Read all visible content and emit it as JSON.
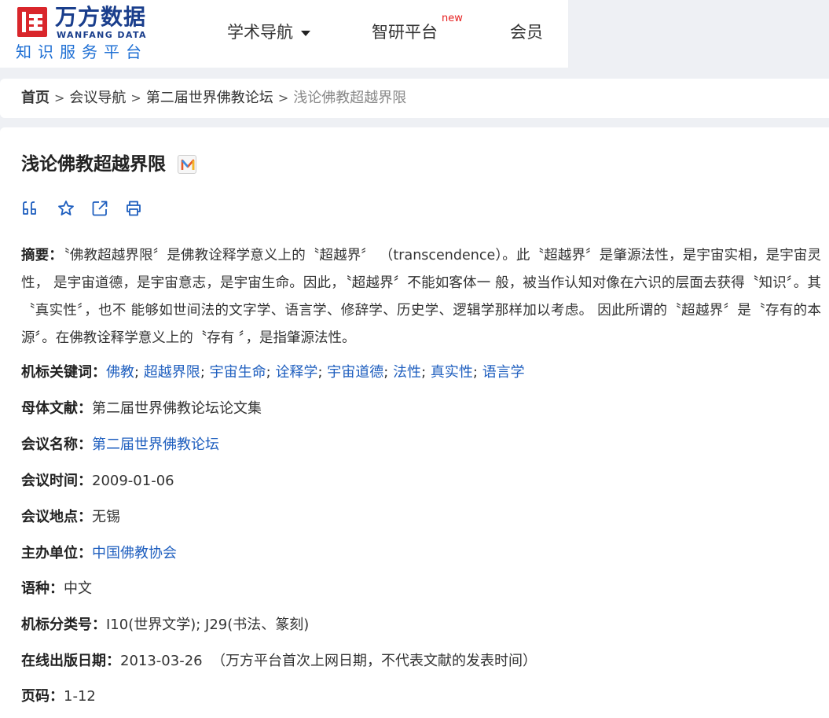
{
  "header": {
    "logo": {
      "cn": "万方数据",
      "en": "WANFANG DATA",
      "sub": "知识服务平台"
    },
    "nav": {
      "academic": "学术导航",
      "zhiyan": "智研平台",
      "zhiyan_badge": "new",
      "vip": "会员"
    }
  },
  "breadcrumb": {
    "home": "首页",
    "sep": ">",
    "level1": "会议导航",
    "level2": "第二届世界佛教论坛",
    "current": "浅论佛教超越界限"
  },
  "article": {
    "title": "浅论佛教超越界限",
    "badge_letter": "M",
    "abstract_label": "摘要：",
    "abstract_text": "〝佛教超越界限〞是佛教诠释学意义上的〝超越界〞 （transcendence）。此〝超越界〞是肇源法性，是宇宙实相，是宇宙灵性， 是宇宙道德，是宇宙意志，是宇宙生命。因此，〝超越界〞不能如客体一 般，被当作认知对像在六识的层面去获得〝知识〞。其〝真实性〞，也不 能够如世间法的文字学、语言学、修辞学、历史学、逻辑学那样加以考虑。 因此所谓的〝超越界〞是〝存有的本源〞。在佛教诠释学意义上的〝存有 〞，是指肇源法性。",
    "keywords_label": "机标关键词：",
    "keywords": [
      "佛教",
      "超越界限",
      "宇宙生命",
      "诠释学",
      "宇宙道德",
      "法性",
      "真实性",
      "语言学"
    ],
    "keyword_sep": ";",
    "source_label": "母体文献：",
    "source_value": "第二届世界佛教论坛论文集",
    "conf_name_label": "会议名称：",
    "conf_name_value": "第二届世界佛教论坛",
    "conf_time_label": "会议时间：",
    "conf_time_value": "2009-01-06",
    "conf_place_label": "会议地点：",
    "conf_place_value": "无锡",
    "host_label": "主办单位：",
    "host_value": "中国佛教协会",
    "lang_label": "语种：",
    "lang_value": "中文",
    "class_label": "机标分类号：",
    "class_value": "I10(世界文学); J29(书法、篆刻)",
    "pubdate_label": "在线出版日期：",
    "pubdate_value": "2013-03-26",
    "pubdate_note": "（万方平台首次上网日期，不代表文献的发表时间）",
    "pages_label": "页码：",
    "pages_value": "1-12"
  },
  "colors": {
    "brand_red": "#d9262b",
    "brand_blue": "#1a3e8c",
    "link_blue": "#1f5fbf",
    "new_red": "#e62020"
  },
  "icons": {
    "cite": "quote-icon",
    "collect": "star-icon",
    "share": "share-icon",
    "print": "print-icon"
  }
}
